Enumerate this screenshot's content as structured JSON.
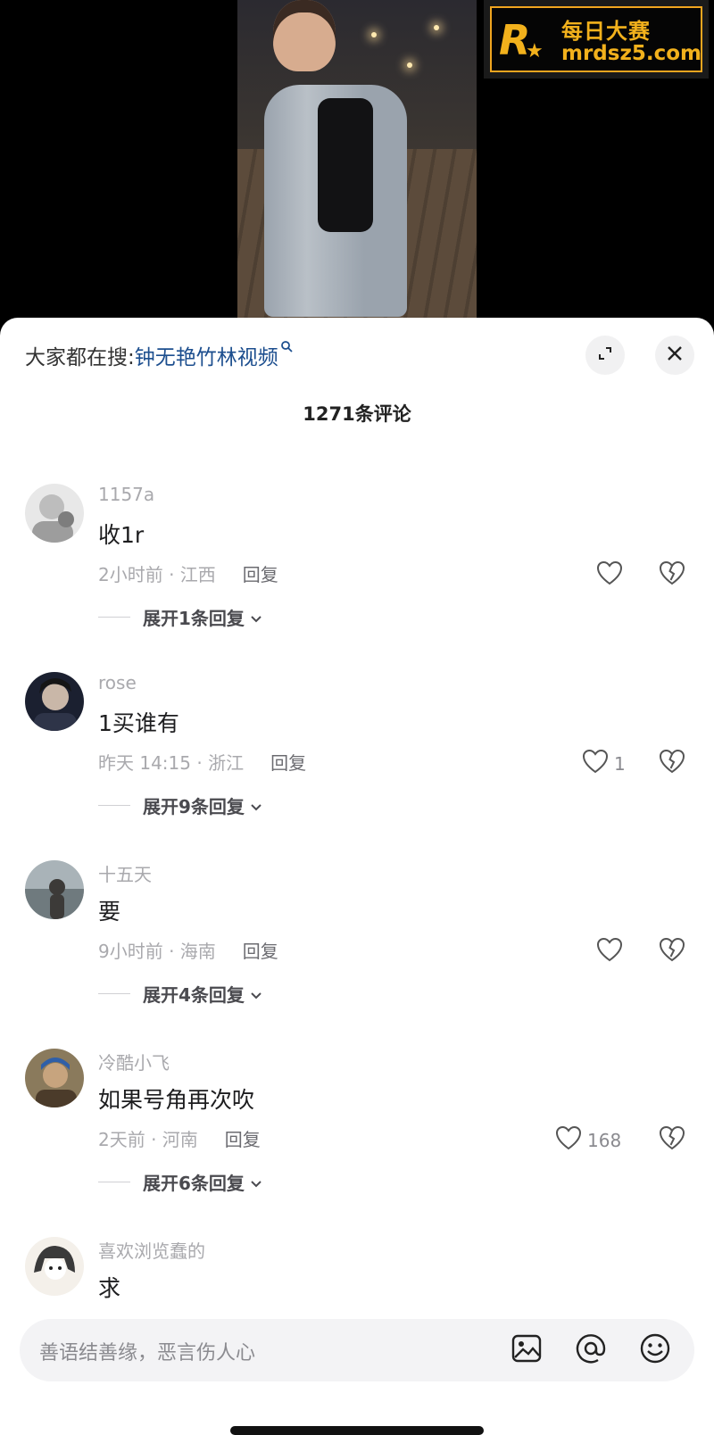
{
  "watermark": {
    "line1": "每日大赛",
    "line2": "mrdsz5.com",
    "logo_letter": "R"
  },
  "search_bar": {
    "prefix": "大家都在搜:",
    "query": "钟无艳竹林视频"
  },
  "header": {
    "comment_count": "1271条评论"
  },
  "comments": [
    {
      "user": "1157a",
      "text": "收1r",
      "time_location": "2小时前 · 江西",
      "reply_label": "回复",
      "likes": "",
      "expand_label": "展开1条回复"
    },
    {
      "user": "rose",
      "text": "1买谁有",
      "time_location": "昨天 14:15 · 浙江",
      "reply_label": "回复",
      "likes": "1",
      "expand_label": "展开9条回复"
    },
    {
      "user": "十五天",
      "text": "要",
      "time_location": "9小时前 · 海南",
      "reply_label": "回复",
      "likes": "",
      "expand_label": "展开4条回复"
    },
    {
      "user": "冷酷小飞",
      "text": "如果号角再次吹",
      "time_location": "2天前 · 河南",
      "reply_label": "回复",
      "likes": "168",
      "expand_label": "展开6条回复"
    },
    {
      "user": "喜欢浏览蠢的",
      "text": "求"
    }
  ],
  "input": {
    "placeholder": "善语结善缘，恶言伤人心"
  }
}
